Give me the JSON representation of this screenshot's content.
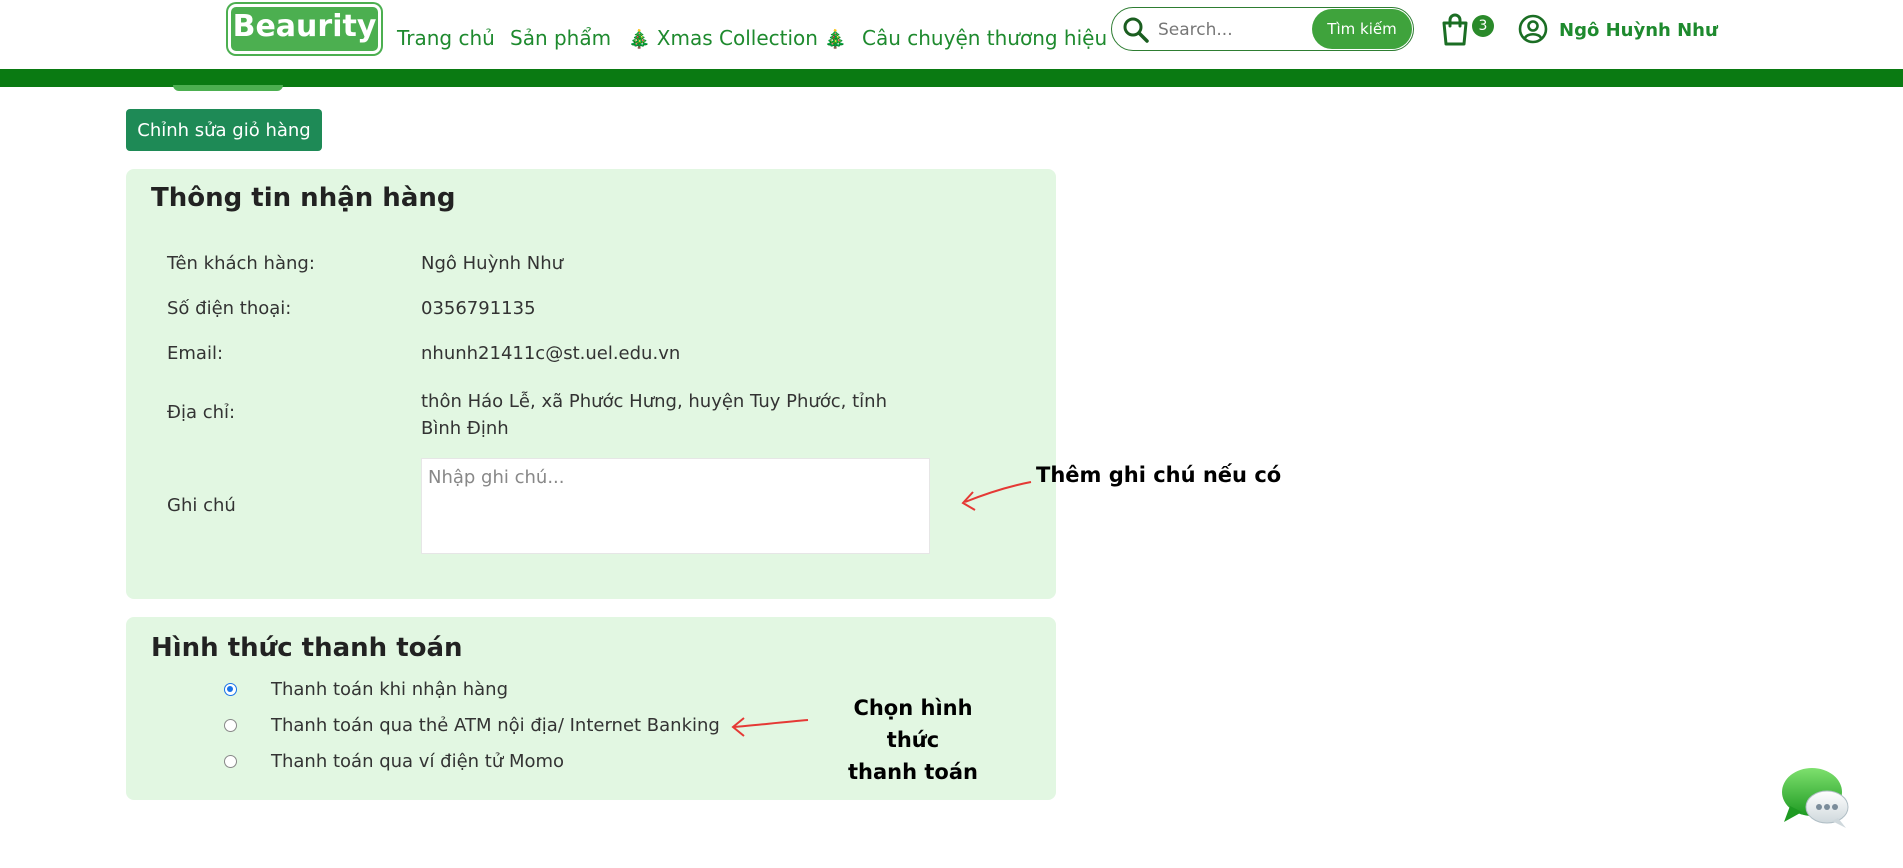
{
  "header": {
    "logo_text": "Beaurity",
    "nav": [
      {
        "label": "Trang chủ"
      },
      {
        "label": "Sản phẩm"
      },
      {
        "label": "Xmas Collection",
        "prefix_icon": "christmas-tree-icon",
        "suffix_icon": "christmas-tree-icon"
      },
      {
        "label": "Câu chuyện thương hiệu"
      }
    ],
    "search": {
      "placeholder": "Search...",
      "button_label": "Tìm kiếm"
    },
    "cart_count": "3",
    "user_name": "Ngô Huỳnh Như",
    "brand_color": "#0a7a12"
  },
  "edit_cart_label": "Chỉnh sửa giỏ hàng",
  "shipping": {
    "title": "Thông tin nhận hàng",
    "rows": [
      {
        "label": "Tên khách hàng:",
        "value": "Ngô Huỳnh Như"
      },
      {
        "label": "Số điện thoại:",
        "value": "0356791135"
      },
      {
        "label": "Email:",
        "value": "nhunh21411c@st.uel.edu.vn"
      },
      {
        "label": "Địa chỉ:",
        "value": "thôn Háo Lễ, xã Phước Hưng, huyện Tuy Phước, tỉnh Bình Định"
      }
    ],
    "note_label": "Ghi chú",
    "note_placeholder": "Nhập ghi chú..."
  },
  "payment": {
    "title": "Hình thức thanh toán",
    "options": [
      {
        "label": "Thanh toán khi nhận hàng",
        "selected": true
      },
      {
        "label": "Thanh toán qua thẻ ATM nội địa/ Internet Banking",
        "selected": false
      },
      {
        "label": "Thanh toán qua ví điện tử Momo",
        "selected": false
      }
    ]
  },
  "annotations": {
    "note_hint": "Thêm ghi chú nếu có",
    "payment_hint_line1": "Chọn hình thức",
    "payment_hint_line2": "thanh toán"
  },
  "chat_icon": "chat-bubbles-icon"
}
